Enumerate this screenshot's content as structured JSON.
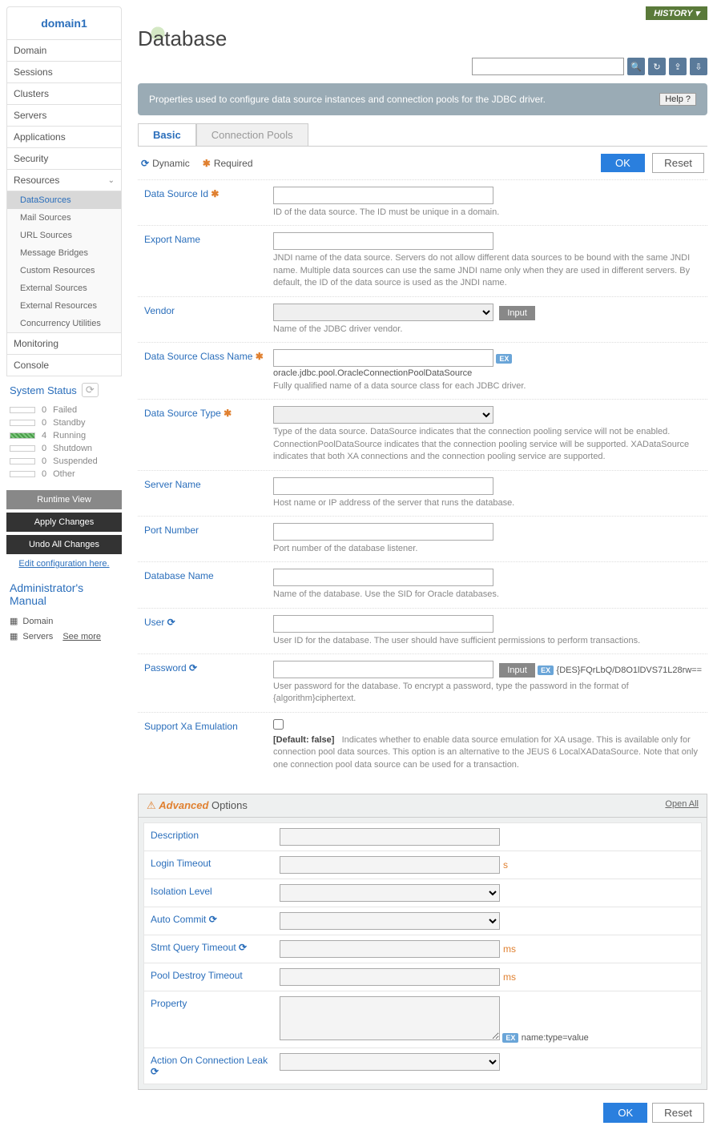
{
  "sidebar": {
    "domain_name": "domain1",
    "nav": [
      "Domain",
      "Sessions",
      "Clusters",
      "Servers",
      "Applications",
      "Security",
      "Resources"
    ],
    "resources_sub": [
      {
        "label": "DataSources",
        "active": true
      },
      {
        "label": "Mail Sources"
      },
      {
        "label": "URL Sources"
      },
      {
        "label": "Message Bridges"
      },
      {
        "label": "Custom Resources"
      },
      {
        "label": "External Sources"
      },
      {
        "label": "External Resources"
      },
      {
        "label": "Concurrency Utilities"
      }
    ],
    "nav2": [
      "Monitoring",
      "Console"
    ],
    "system_status_label": "System Status",
    "statuses": [
      {
        "count": "0",
        "label": "Failed"
      },
      {
        "count": "0",
        "label": "Standby"
      },
      {
        "count": "4",
        "label": "Running",
        "running": true
      },
      {
        "count": "0",
        "label": "Shutdown"
      },
      {
        "count": "0",
        "label": "Suspended"
      },
      {
        "count": "0",
        "label": "Other"
      }
    ],
    "runtime_view": "Runtime View",
    "apply_changes": "Apply Changes",
    "undo_changes": "Undo All Changes",
    "edit_config": "Edit configuration here.",
    "admin_manual": "Administrator's Manual",
    "manual_links": [
      "Domain",
      "Servers"
    ],
    "see_more": "See more"
  },
  "header": {
    "history": "HISTORY",
    "page_title": "Database"
  },
  "banner": {
    "text": "Properties used to configure data source instances and connection pools for the JDBC driver.",
    "help": "Help"
  },
  "tabs": [
    {
      "label": "Basic",
      "active": true
    },
    {
      "label": "Connection Pools"
    }
  ],
  "legend": {
    "dynamic": "Dynamic",
    "required": "Required"
  },
  "actions": {
    "ok": "OK",
    "reset": "Reset"
  },
  "fields": [
    {
      "label": "Data Source Id",
      "req": true,
      "desc": "ID of the data source. The ID must be unique in a domain.",
      "type": "text"
    },
    {
      "label": "Export Name",
      "desc": "JNDI name of the data source. Servers do not allow different data sources to be bound with the same JNDI name. Multiple data sources can use the same JNDI name only when they are used in different servers. By default, the ID of the data source is used as the JNDI name.",
      "type": "text"
    },
    {
      "label": "Vendor",
      "desc": "Name of the JDBC driver vendor.",
      "type": "select",
      "after_btn": "Input"
    },
    {
      "label": "Data Source Class Name",
      "req": true,
      "desc": "Fully qualified name of a data source class for each JDBC driver.",
      "type": "text",
      "ex": "oracle.jdbc.pool.OracleConnectionPoolDataSource"
    },
    {
      "label": "Data Source Type",
      "req": true,
      "desc": "Type of the data source. DataSource indicates that the connection pooling service will not be enabled. ConnectionPoolDataSource indicates that the connection pooling service will be supported. XADataSource indicates that both XA connections and the connection pooling service are supported.",
      "type": "select"
    },
    {
      "label": "Server Name",
      "desc": "Host name or IP address of the server that runs the database.",
      "type": "text"
    },
    {
      "label": "Port Number",
      "desc": "Port number of the database listener.",
      "type": "text"
    },
    {
      "label": "Database Name",
      "desc": "Name of the database. Use the SID for Oracle databases.",
      "type": "text"
    },
    {
      "label": "User",
      "dyn": true,
      "desc": "User ID for the database. The user should have sufficient permissions to perform transactions.",
      "type": "text"
    },
    {
      "label": "Password",
      "dyn": true,
      "desc": "User password for the database. To encrypt a password, type the password in the format of {algorithm}ciphertext.",
      "type": "text",
      "after_btn": "Input",
      "ex": "{DES}FQrLbQ/D8O1lDVS71L28rw=="
    },
    {
      "label": "Support Xa Emulation",
      "type": "checkbox",
      "default": "[Default: false]",
      "desc": "Indicates whether to enable data source emulation for XA usage. This is available only for connection pool data sources. This option is an alternative to the JEUS 6 LocalXADataSource. Note that only one connection pool data source can be used for a transaction."
    }
  ],
  "advanced": {
    "title_em": "Advanced",
    "title_rest": " Options",
    "open_all": "Open All",
    "fields": [
      {
        "label": "Description",
        "type": "text"
      },
      {
        "label": "Login Timeout",
        "type": "text",
        "unit": "s"
      },
      {
        "label": "Isolation Level",
        "type": "select"
      },
      {
        "label": "Auto Commit",
        "dyn": true,
        "type": "select"
      },
      {
        "label": "Stmt Query Timeout",
        "dyn": true,
        "type": "text",
        "unit": "ms"
      },
      {
        "label": "Pool Destroy Timeout",
        "type": "text",
        "unit": "ms"
      },
      {
        "label": "Property",
        "type": "textarea",
        "ex": "name:type=value"
      },
      {
        "label": "Action On Connection Leak",
        "dyn": true,
        "type": "select"
      }
    ]
  }
}
